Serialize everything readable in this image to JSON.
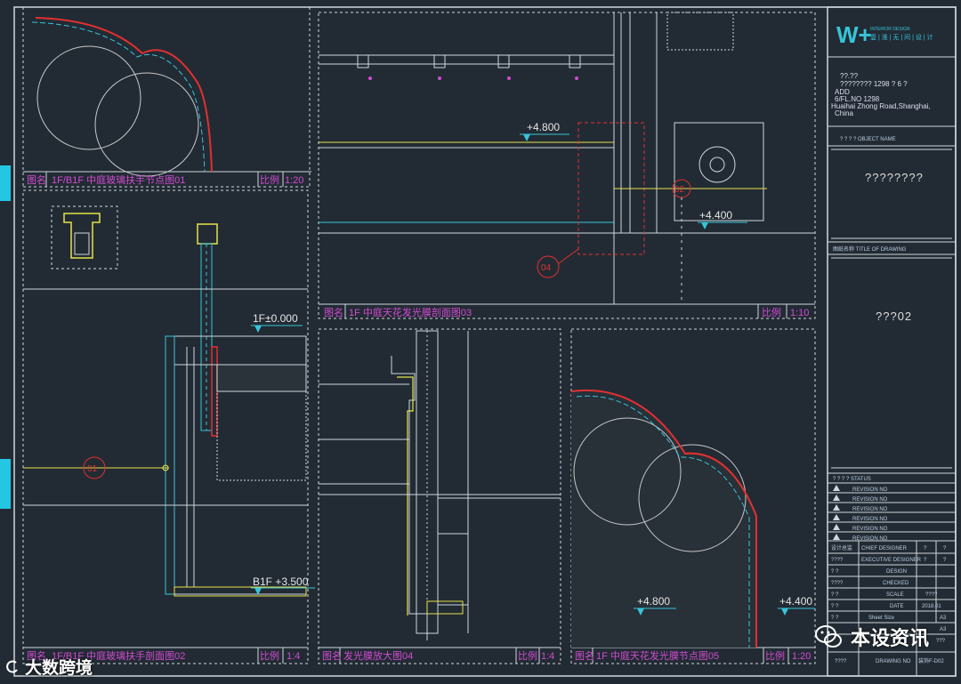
{
  "panels": {
    "p01": {
      "name_label": "图名",
      "title": "1F/B1F 中庭玻璃扶手节点图01",
      "scale_label": "比例",
      "scale": "1:20"
    },
    "p02": {
      "name_label": "图名",
      "title": "1F/B1F 中庭玻璃扶手剖面图02",
      "scale_label": "比例",
      "scale": "1:4"
    },
    "p03": {
      "name_label": "图名",
      "title": "1F 中庭天花发光膜剖面图03",
      "scale_label": "比例",
      "scale": "1:10"
    },
    "p04": {
      "name_label": "图名",
      "title": "发光膜放大图04",
      "scale_label": "比例",
      "scale": "1:4"
    },
    "p05": {
      "name_label": "图名",
      "title": "1F 中庭天花发光膜节点图05",
      "scale_label": "比例",
      "scale": "1:20"
    }
  },
  "annotations": {
    "lvl_1f": "1F±0.000",
    "lvl_b1f": "B1F  +3.500",
    "lvl_4800_top": "+4.800",
    "lvl_4400_top": "+4.400",
    "lvl_4800_bottom": "+4.800",
    "lvl_4400_bottom": "+4.400",
    "callout_01": "01",
    "callout_04": "04",
    "callout_02": "02"
  },
  "title_block": {
    "logo_mark": "W+",
    "logo_en": "INTERIOR DESIGN",
    "logo_cn": "壹 | 淮 | 无 | 间 | 设 | 计",
    "addr_line1": "??.??",
    "addr_line2": "????????  1298  ?  6  ?",
    "addr_line3": "ADD",
    "addr_line4": "6/FL.NO 1298",
    "addr_line5": "Huaihai Zhong Road,Shanghai,",
    "addr_line6": "China",
    "project_label": "? ? ? ?    OBJECT NAME",
    "project_value": "????????",
    "drawing_label": "图纸名称     TITLE OF DRAWING",
    "drawing_value": "???02",
    "status_label": "? ? ? ?     STATUS",
    "revisions": [
      "REVISION NO",
      "REVISION NO",
      "REVISION NO",
      "REVISION NO",
      "REVISION NO",
      "REVISION NO"
    ],
    "rows": [
      {
        "k": "设计总监",
        "v": "CHIEF DESIGNER",
        "a": "?",
        "b": "?"
      },
      {
        "k": "????",
        "v": "EXECUTIVE DESIGNER",
        "a": "?",
        "b": "?"
      },
      {
        "k": "? ?",
        "v": "DESIGN",
        "a": "",
        "b": ""
      },
      {
        "k": "????",
        "v": "CHECKED",
        "a": "",
        "b": ""
      },
      {
        "k": "? ?",
        "v": "SCALE",
        "a": "????",
        "b": ""
      },
      {
        "k": "? ?",
        "v": "DATE",
        "a": "2018.01",
        "b": ""
      },
      {
        "k": "? ?",
        "v": "Sheet Size",
        "a": "A3",
        "b": ""
      },
      {
        "k": "",
        "v": "",
        "a": "A3",
        "b": ""
      },
      {
        "k": "",
        "v": "",
        "a": "???",
        "b": ""
      },
      {
        "k": "????",
        "v": "DRAWING NO",
        "a": "装饰F-D02",
        "b": ""
      }
    ]
  },
  "watermarks": {
    "right": "本设资讯",
    "left": "大数跨境"
  },
  "colors": {
    "background": "#222b34",
    "frame": "#cfd6dc",
    "cyan": "#37c4da",
    "magenta": "#d24bd2",
    "yellow": "#e8e24a",
    "red": "#e03030"
  }
}
